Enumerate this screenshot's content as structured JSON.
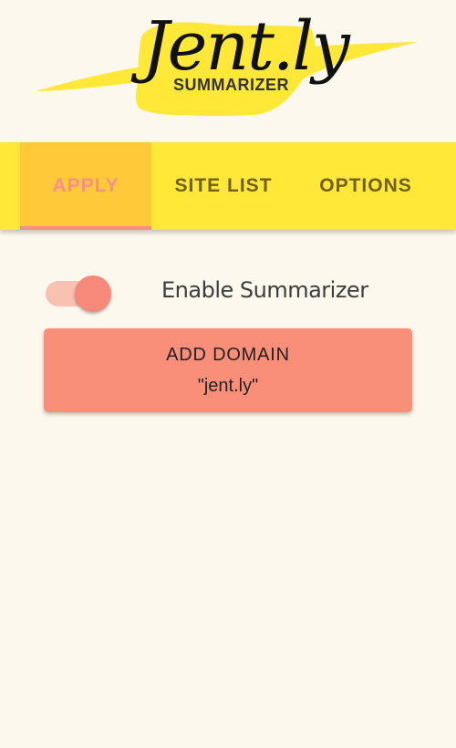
{
  "logo": {
    "brand": "Jent.ly",
    "subtitle": "SUMMARIZER"
  },
  "tabs": [
    {
      "label": "APPLY",
      "active": true
    },
    {
      "label": "SITE LIST",
      "active": false
    },
    {
      "label": "OPTIONS",
      "active": false
    }
  ],
  "apply": {
    "toggle_label": "Enable Summarizer",
    "toggle_on": true,
    "add_button": {
      "label": "ADD DOMAIN",
      "domain": "\"jent.ly\""
    }
  },
  "colors": {
    "background": "#fdf8ed",
    "tabbar": "#ffe838",
    "active_tab": "#ffc93a",
    "accent": "#f98e79",
    "logo_brush": "#ffe838"
  }
}
